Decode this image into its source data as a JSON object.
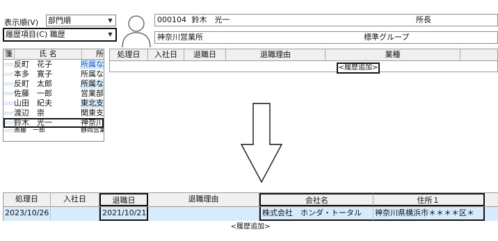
{
  "top": {
    "display_order_label": "表示順(V)",
    "display_order_value": "部門順",
    "history_item_value": "履歴項目(C) 職歴"
  },
  "employee": {
    "code": "000104",
    "name": "鈴木　光一",
    "title": "所長",
    "office": "神奈川営業所",
    "group": "標準グループ"
  },
  "list": {
    "headers": [
      "箋",
      "氏 名",
      "所"
    ],
    "rows": [
      {
        "name": "反町　花子",
        "dept": "所属なし"
      },
      {
        "name": "本多　寛子",
        "dept": "所属なし"
      },
      {
        "name": "反町　太郎",
        "dept": "所属なし"
      },
      {
        "name": "佐藤　一郎",
        "dept": "営業部"
      },
      {
        "name": "山田　紀夫",
        "dept": "東北支店"
      },
      {
        "name": "渡辺　崇",
        "dept": "関東支店"
      },
      {
        "name": "鈴木　光一",
        "dept": "神奈川"
      },
      {
        "name": "斎藤　一郎",
        "dept": "静岡営業所"
      }
    ]
  },
  "history_top": {
    "headers": [
      "処理日",
      "入社日",
      "退職日",
      "退職理由",
      "業種"
    ],
    "add_label": "<履歴追加>"
  },
  "history_bottom": {
    "headers": [
      "処理日",
      "入社日",
      "退職日",
      "退職理由",
      "会社名",
      "住所１"
    ],
    "row": [
      "2023/10/26",
      "",
      "2021/10/21",
      "",
      "株式会社　ホンダ・トータル",
      "神奈川県横浜市＊＊＊＊区＊"
    ],
    "add_label": "<履歴追加>"
  },
  "icons": {
    "avatar": "person-silhouette-icon",
    "arrow": "down-arrow-icon",
    "dropdown": "chevron-down-icon"
  }
}
